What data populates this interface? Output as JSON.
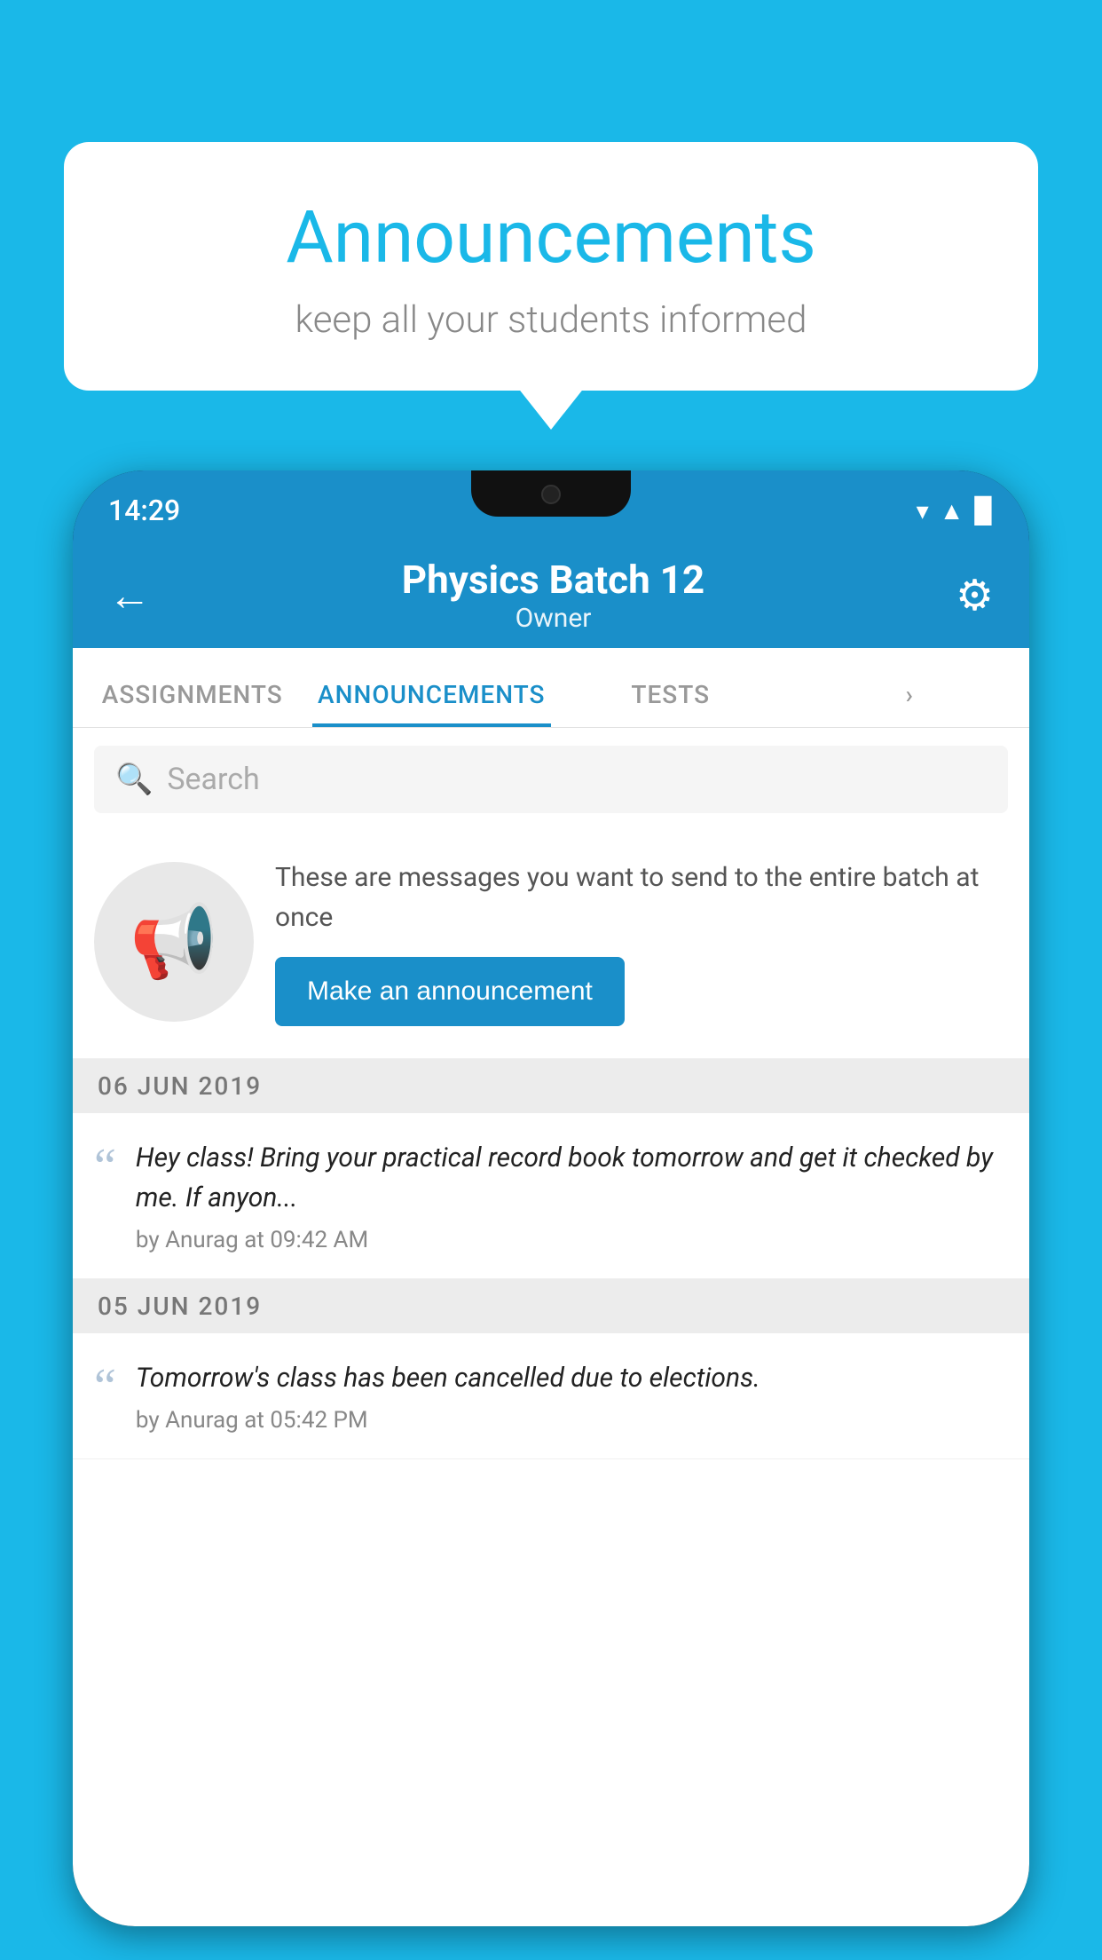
{
  "speech_bubble": {
    "title": "Announcements",
    "subtitle": "keep all your students informed"
  },
  "status_bar": {
    "time": "14:29",
    "wifi": "▼",
    "signal": "▲",
    "battery": "▉"
  },
  "app_header": {
    "title": "Physics Batch 12",
    "subtitle": "Owner",
    "back_label": "←",
    "gear_label": "⚙"
  },
  "tabs": [
    {
      "label": "ASSIGNMENTS",
      "active": false
    },
    {
      "label": "ANNOUNCEMENTS",
      "active": true
    },
    {
      "label": "TESTS",
      "active": false
    },
    {
      "label": "›",
      "active": false
    }
  ],
  "search": {
    "placeholder": "Search"
  },
  "announcement_promo": {
    "description": "These are messages you want to send to the entire batch at once",
    "button_label": "Make an announcement"
  },
  "announcements": [
    {
      "date": "06  JUN  2019",
      "message": "Hey class! Bring your practical record book tomorrow and get it checked by me. If anyon...",
      "meta": "by Anurag at 09:42 AM"
    },
    {
      "date": "05  JUN  2019",
      "message": "Tomorrow's class has been cancelled due to elections.",
      "meta": "by Anurag at 05:42 PM"
    }
  ]
}
